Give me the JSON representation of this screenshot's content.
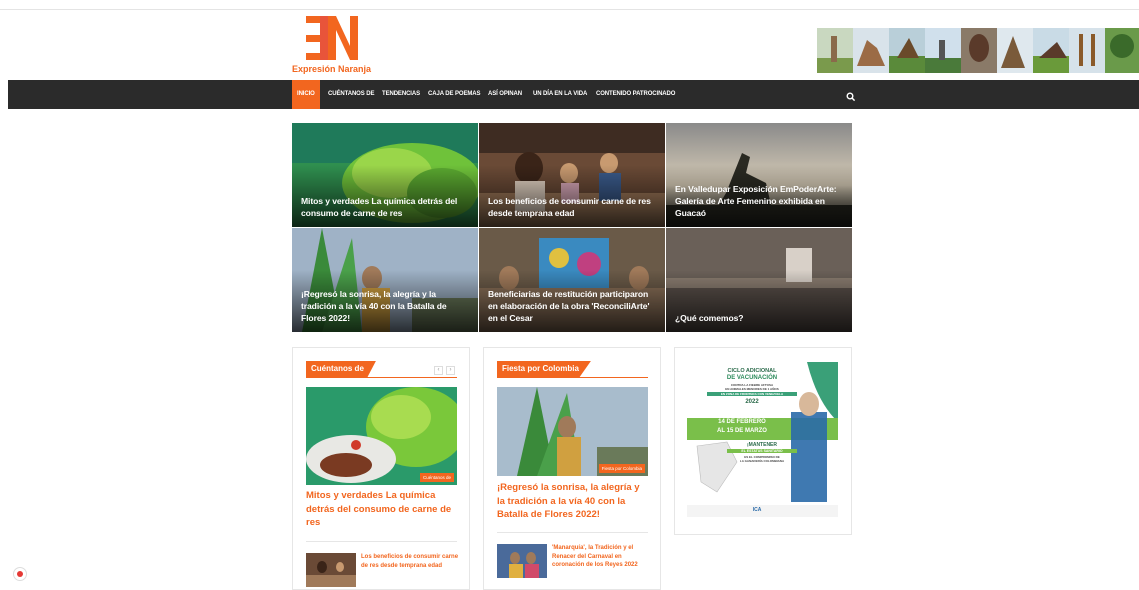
{
  "site": {
    "logo_name": "Expresión Naranja",
    "brand_color": "#f2661f"
  },
  "nav": {
    "items": [
      {
        "label": "INICIO",
        "active": true
      },
      {
        "label": "CUÉNTANOS DE"
      },
      {
        "label": "TENDENCIAS"
      },
      {
        "label": "CAJA DE POEMAS"
      },
      {
        "label": "ASÍ OPINAN"
      },
      {
        "label": "UN DÍA EN LA VIDA"
      },
      {
        "label": "CONTENIDO PATROCINADO"
      }
    ],
    "search_icon": "search-icon"
  },
  "grid": [
    {
      "title": "Mitos y verdades La química detrás del consumo de carne de res"
    },
    {
      "title": "Los beneficios de consumir carne de res desde temprana edad"
    },
    {
      "title": "En Valledupar Exposición EmPoderArte: Galería de Arte Femenino exhibida en Guacaó"
    },
    {
      "title": "¡Regresó la sonrisa, la alegría y la tradición a la vía 40 con la Batalla de Flores 2022!"
    },
    {
      "title": "Beneficiarias de restitución participaron en elaboración de la obra 'ReconciliArte' en el Cesar"
    },
    {
      "title": "¿Qué comemos?"
    }
  ],
  "box1": {
    "heading": "Cuéntanos de",
    "badge": "Cuéntanos de",
    "title": "Mitos y verdades La química detrás del consumo de carne de res",
    "small_title": "Los beneficios de consumir carne de res desde temprana edad",
    "prev": "‹",
    "next": "›"
  },
  "box2": {
    "heading": "Fiesta por Colombia",
    "badge": "Fiesta por Colombia",
    "title": "¡Regresó la sonrisa, la alegría y la tradición a la vía 40 con la Batalla de Flores 2022!",
    "small_title": "'Manarquía', la Tradición y el Renacer del Carnaval en coronación de los Reyes 2022"
  },
  "ad": {
    "line1": "CICLO ADICIONAL",
    "line2": "DE VACUNACIÓN",
    "line3": "CONTRA LA FIEBRE AFTOSA",
    "line4": "EN ANIMALES MENORES DE 1 AÑOS",
    "line5": "EN ZONA DE FRONTERA CON VENEZUELA",
    "year": "2022",
    "dates_1": "14 DE FEBRERO",
    "dates_2": "AL 15 DE MARZO",
    "mantener": "¡MANTENER",
    "line6": "EL ESTATUS SANITARIO",
    "line7": "ES EL COMPROMISO DE",
    "line8": "LA GANADERÍA COLOMBIANA",
    "logos": "ICA"
  }
}
